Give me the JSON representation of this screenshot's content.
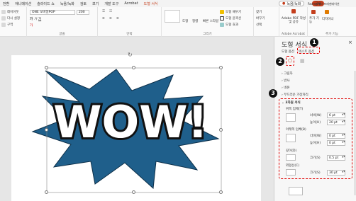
{
  "tabs": [
    "전환",
    "애니메이션",
    "슬라이드 쇼",
    "녹음/녹화",
    "검토",
    "보기",
    "개발 도구",
    "Acrobat",
    "도형 서식"
  ],
  "active_tab": "도형 서식",
  "record_button": "녹음/녹화",
  "share_button": "공유",
  "ribbon": {
    "slides": {
      "layout": "레이아웃",
      "reset": "다시 설정",
      "section": "구역"
    },
    "font": {
      "name": "ONE 모바일POP",
      "size": "200",
      "label": "글꼴"
    },
    "paragraph": {
      "label": "단락"
    },
    "drawing": {
      "shapes": "도형",
      "arrange": "정렬",
      "quick_styles": "빠른 스타일",
      "fill": "도형 채우기",
      "outline": "도형 윤곽선",
      "effects": "도형 효과",
      "label": "그리기"
    },
    "editing": {
      "find": "찾기",
      "replace": "바꾸기",
      "select": "선택"
    },
    "adobe": {
      "create": "Adobe PDF 작성 및 공유",
      "label": "Adobe Acrobat"
    },
    "addins": {
      "addins": "추가 기능",
      "designer": "디자이너",
      "label": "추가 기능"
    },
    "reamo": "Reamo에서 프레젠테이션"
  },
  "slide": {
    "text": "WOW!",
    "shape_fill": "#1f5f8b"
  },
  "pane": {
    "title": "도형 서식",
    "tab_shape": "도형 옵션",
    "tab_text": "텍스트 옵션",
    "sections": [
      "그림자",
      "반사",
      "네온",
      "부드러운 가장자리"
    ],
    "format3d": {
      "title": "3차원 서식",
      "top_bevel": "위쪽 입체(T)",
      "bottom_bevel": "아래쪽 입체(B)",
      "depth": "깊이(D)",
      "contour": "외형선(C)",
      "width": "너비(W)",
      "height": "높이(H)",
      "size": "크기(S)",
      "top_width": "6 pt",
      "top_height": "20 pt",
      "bottom_width": "0 pt",
      "bottom_height": "0 pt",
      "depth_size": "0.5 pt",
      "contour_size": "30 pt"
    }
  },
  "markers": [
    "1",
    "2",
    "3"
  ],
  "colors": {
    "accent": "#c43e1c",
    "annotation": "#e00000",
    "shape": "#1f5f8b"
  }
}
